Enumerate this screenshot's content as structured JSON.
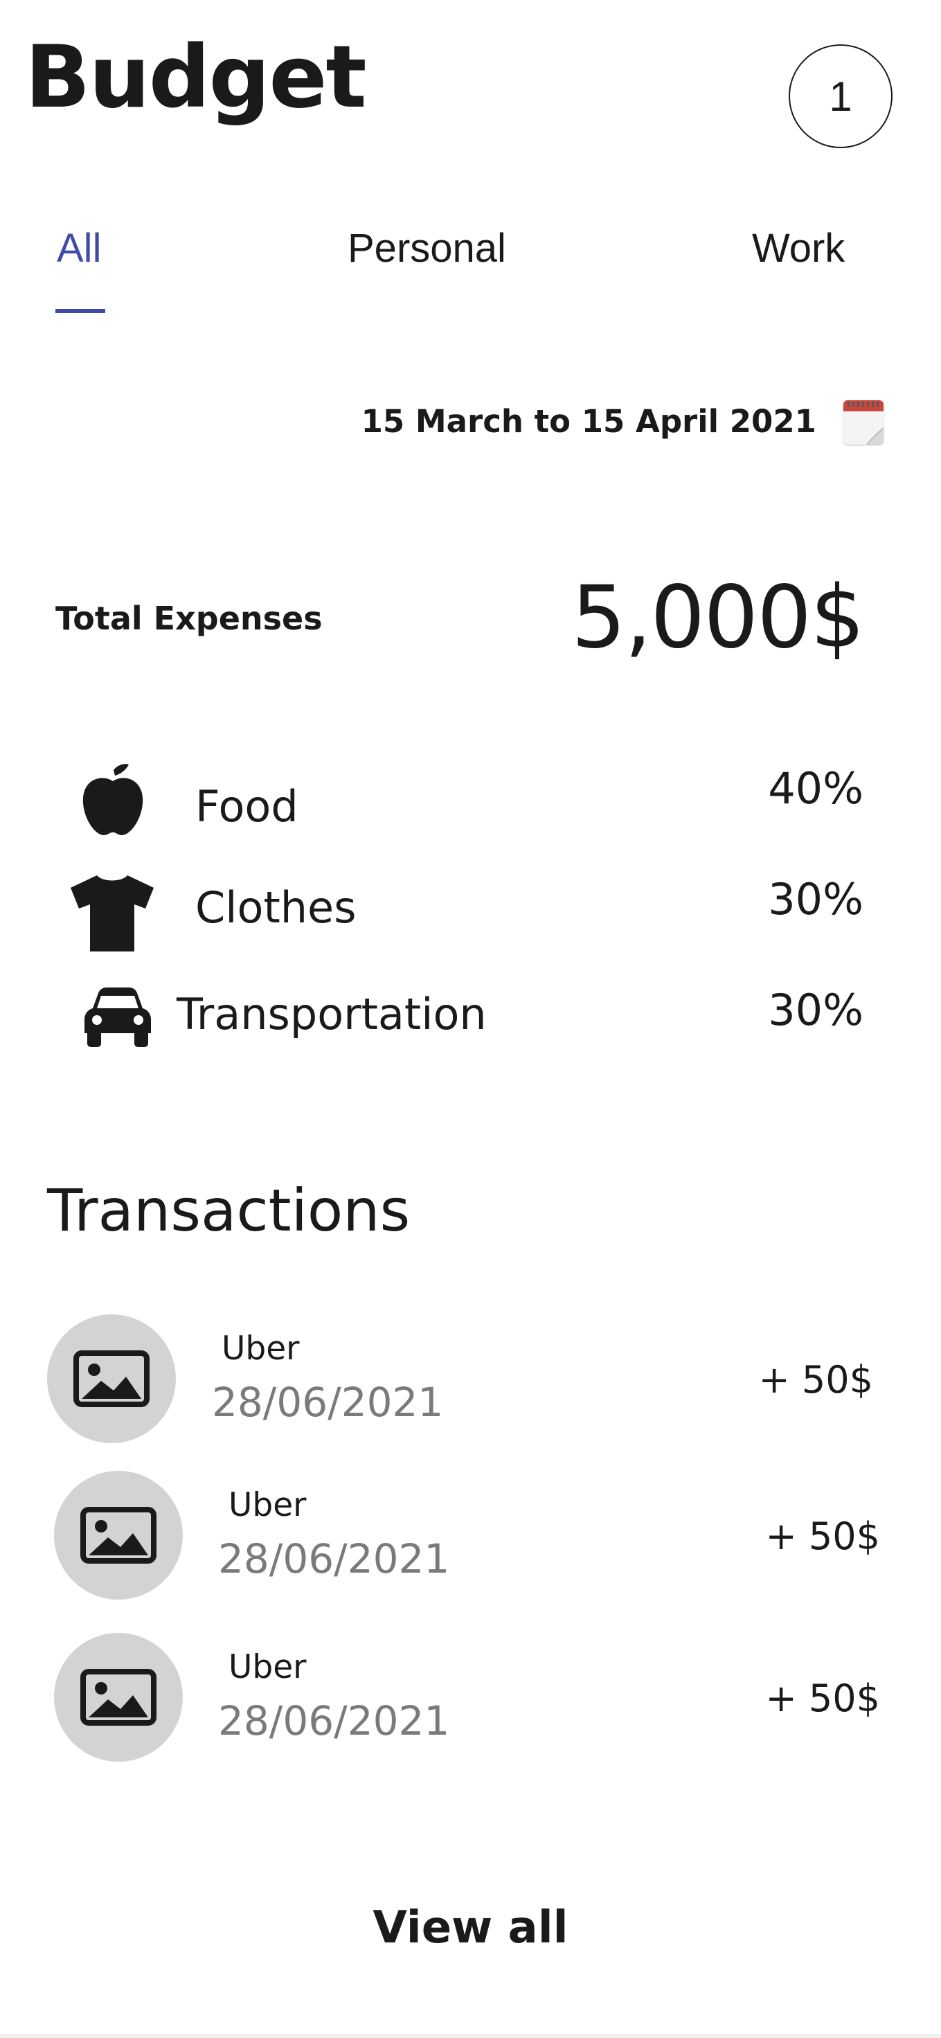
{
  "header": {
    "title": "Budget",
    "avatar_label": "1"
  },
  "tabs": [
    {
      "label": "All",
      "active": true
    },
    {
      "label": "Personal",
      "active": false
    },
    {
      "label": "Work",
      "active": false
    }
  ],
  "period": {
    "label": "15 March to 15 April 2021",
    "icon": "calendar-icon"
  },
  "summary": {
    "total_label": "Total Expenses",
    "total_value": "5,000$"
  },
  "categories": [
    {
      "icon": "apple-icon",
      "label": "Food",
      "percent": "40%"
    },
    {
      "icon": "tshirt-icon",
      "label": "Clothes",
      "percent": "30%"
    },
    {
      "icon": "car-icon",
      "label": "Transportation",
      "percent": "30%"
    }
  ],
  "transactions": {
    "title": "Transactions",
    "items": [
      {
        "icon": "image-placeholder-icon",
        "name": "Uber",
        "date": "28/06/2021",
        "amount": "+ 50$"
      },
      {
        "icon": "image-placeholder-icon",
        "name": "Uber",
        "date": "28/06/2021",
        "amount": "+ 50$"
      },
      {
        "icon": "image-placeholder-icon",
        "name": "Uber",
        "date": "28/06/2021",
        "amount": "+ 50$"
      }
    ],
    "view_all_label": "View all"
  },
  "colors": {
    "accent": "#3f4ba6",
    "text": "#1a1a1a",
    "muted_text": "#7a7a7a",
    "thumb_bg": "#d3d3d3"
  }
}
